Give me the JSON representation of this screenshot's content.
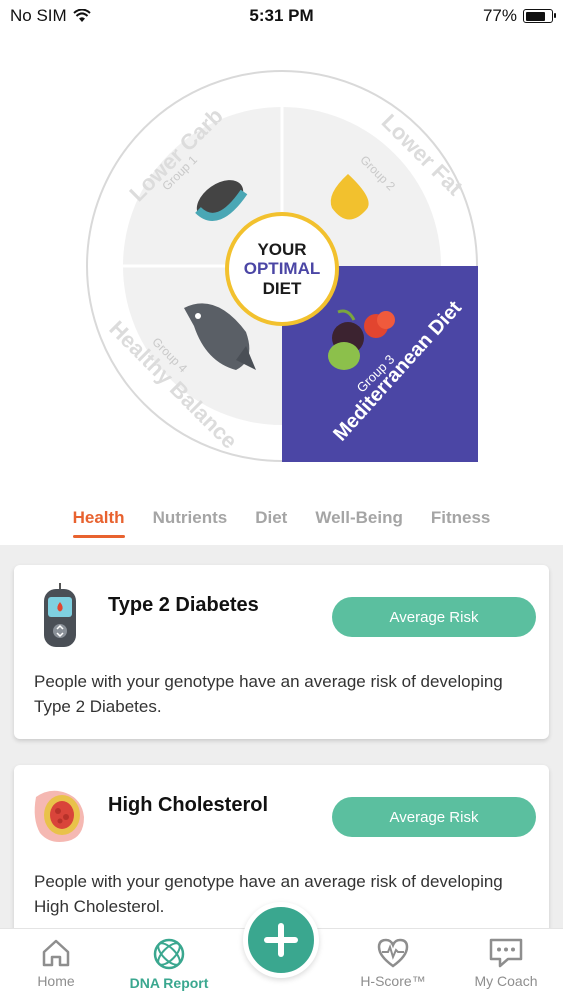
{
  "status_bar": {
    "carrier": "No SIM",
    "time": "5:31 PM",
    "battery": "77%",
    "battery_level": 0.77
  },
  "wheel": {
    "segments": [
      {
        "diet": "Lower Carb",
        "group": "Group 1"
      },
      {
        "diet": "Lower Fat",
        "group": "Group 2"
      },
      {
        "diet": "Mediterranean Diet",
        "group": "Group 3"
      },
      {
        "diet": "Healthy Balance",
        "group": "Group 4"
      }
    ],
    "center": {
      "line1": "YOUR",
      "line2": "OPTIMAL",
      "line3": "DIET"
    },
    "accent_color": "#4b46a5"
  },
  "tabs": [
    {
      "label": "Health",
      "active": true
    },
    {
      "label": "Nutrients",
      "active": false
    },
    {
      "label": "Diet",
      "active": false
    },
    {
      "label": "Well-Being",
      "active": false
    },
    {
      "label": "Fitness",
      "active": false
    }
  ],
  "cards": [
    {
      "title": "Type 2 Diabetes",
      "risk": "Average Risk",
      "description": "People with your genotype have an average risk of developing Type 2 Diabetes.",
      "icon": "glucose-meter-icon"
    },
    {
      "title": "High Cholesterol",
      "risk": "Average Risk",
      "description": "People with your genotype have an average risk of developing High Cholesterol.",
      "icon": "artery-icon"
    }
  ],
  "bottom_nav": {
    "items": [
      {
        "label": "Home",
        "icon": "home-icon"
      },
      {
        "label": "DNA Report",
        "icon": "dna-icon",
        "active": true
      },
      {
        "label": "H-Score™",
        "icon": "heart-rate-icon"
      },
      {
        "label": "My Coach",
        "icon": "chat-icon"
      }
    ],
    "fab_icon": "plus-icon"
  },
  "colors": {
    "accent_orange": "#e8622f",
    "teal": "#3aa78f",
    "risk_green": "#5bbf9f",
    "purple": "#4b46a5",
    "yellow": "#f2c12e"
  }
}
